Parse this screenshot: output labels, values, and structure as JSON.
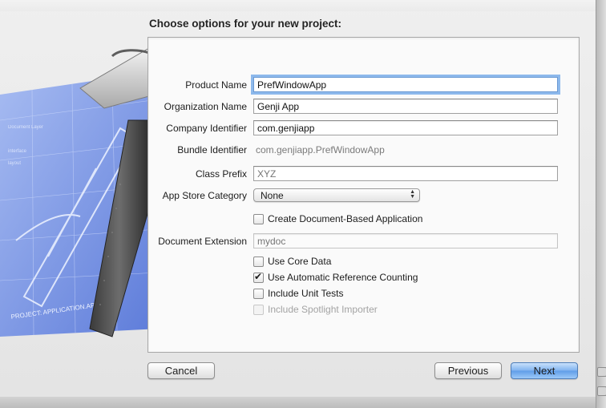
{
  "dialog": {
    "heading": "Choose options for your new project:",
    "art_caption": "PROJECT: APPLICATION.APP"
  },
  "form": {
    "product_name": {
      "label": "Product Name",
      "value": "PrefWindowApp"
    },
    "organization_name": {
      "label": "Organization Name",
      "value": "Genji App"
    },
    "company_identifier": {
      "label": "Company Identifier",
      "value": "com.genjiapp"
    },
    "bundle_identifier": {
      "label": "Bundle Identifier",
      "value": "com.genjiapp.PrefWindowApp"
    },
    "class_prefix": {
      "label": "Class Prefix",
      "placeholder": "XYZ"
    },
    "app_store_category": {
      "label": "App Store Category",
      "selected": "None"
    },
    "create_document_based": {
      "label": "Create Document-Based Application",
      "checked": false
    },
    "document_extension": {
      "label": "Document Extension",
      "placeholder": "mydoc"
    },
    "use_core_data": {
      "label": "Use Core Data",
      "checked": false
    },
    "use_arc": {
      "label": "Use Automatic Reference Counting",
      "checked": true
    },
    "include_unit_tests": {
      "label": "Include Unit Tests",
      "checked": false
    },
    "include_spotlight_importer": {
      "label": "Include Spotlight Importer",
      "checked": false,
      "enabled": false
    }
  },
  "buttons": {
    "cancel": "Cancel",
    "previous": "Previous",
    "next": "Next"
  },
  "colors": {
    "focus_ring": "#8db9ec",
    "primary_button": "#6aa5ec",
    "blueprint": "#5b7fe0"
  }
}
